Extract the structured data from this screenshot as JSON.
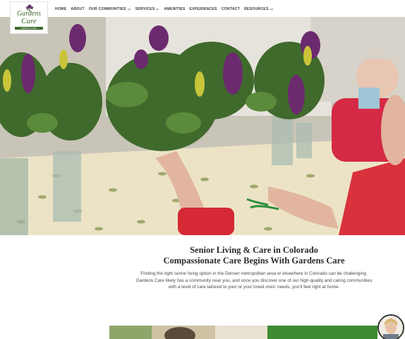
{
  "logo": {
    "line1": "Gardens",
    "line2": "Care",
    "tagline": "SENIOR LIVING"
  },
  "nav": {
    "items": [
      {
        "label": "HOME",
        "dropdown": false
      },
      {
        "label": "ABOUT",
        "dropdown": false
      },
      {
        "label": "OUR COMMUNITIES",
        "dropdown": true
      },
      {
        "label": "SERVICES",
        "dropdown": true
      },
      {
        "label": "AMENITIES",
        "dropdown": false
      },
      {
        "label": "EXPERIENCES",
        "dropdown": false
      },
      {
        "label": "CONTACT",
        "dropdown": false
      },
      {
        "label": "RESOURCES",
        "dropdown": true
      }
    ]
  },
  "hero": {
    "image": "seniors-arranging-flowers"
  },
  "intro": {
    "heading_line1": "Senior Living & Care in Colorado",
    "heading_line2": "Compassionate Care Begins With Gardens Care",
    "paragraph": "Finding the right senior living option in the Denver metropolitan area or elsewhere in Colorado can be challenging. Gardens Care likely has a community near you, and once you discover one of our high-quality and caring communities with a level of care tailored to your or your loved ones' needs, you'll feel right at home."
  },
  "colors": {
    "brand_green": "#3d6b2e",
    "strip_green": "#3e8a33",
    "nav_text": "#3b3b3b"
  },
  "icons": {
    "logo_mark": "flower-icon",
    "dropdown": "chevron-down-icon"
  }
}
